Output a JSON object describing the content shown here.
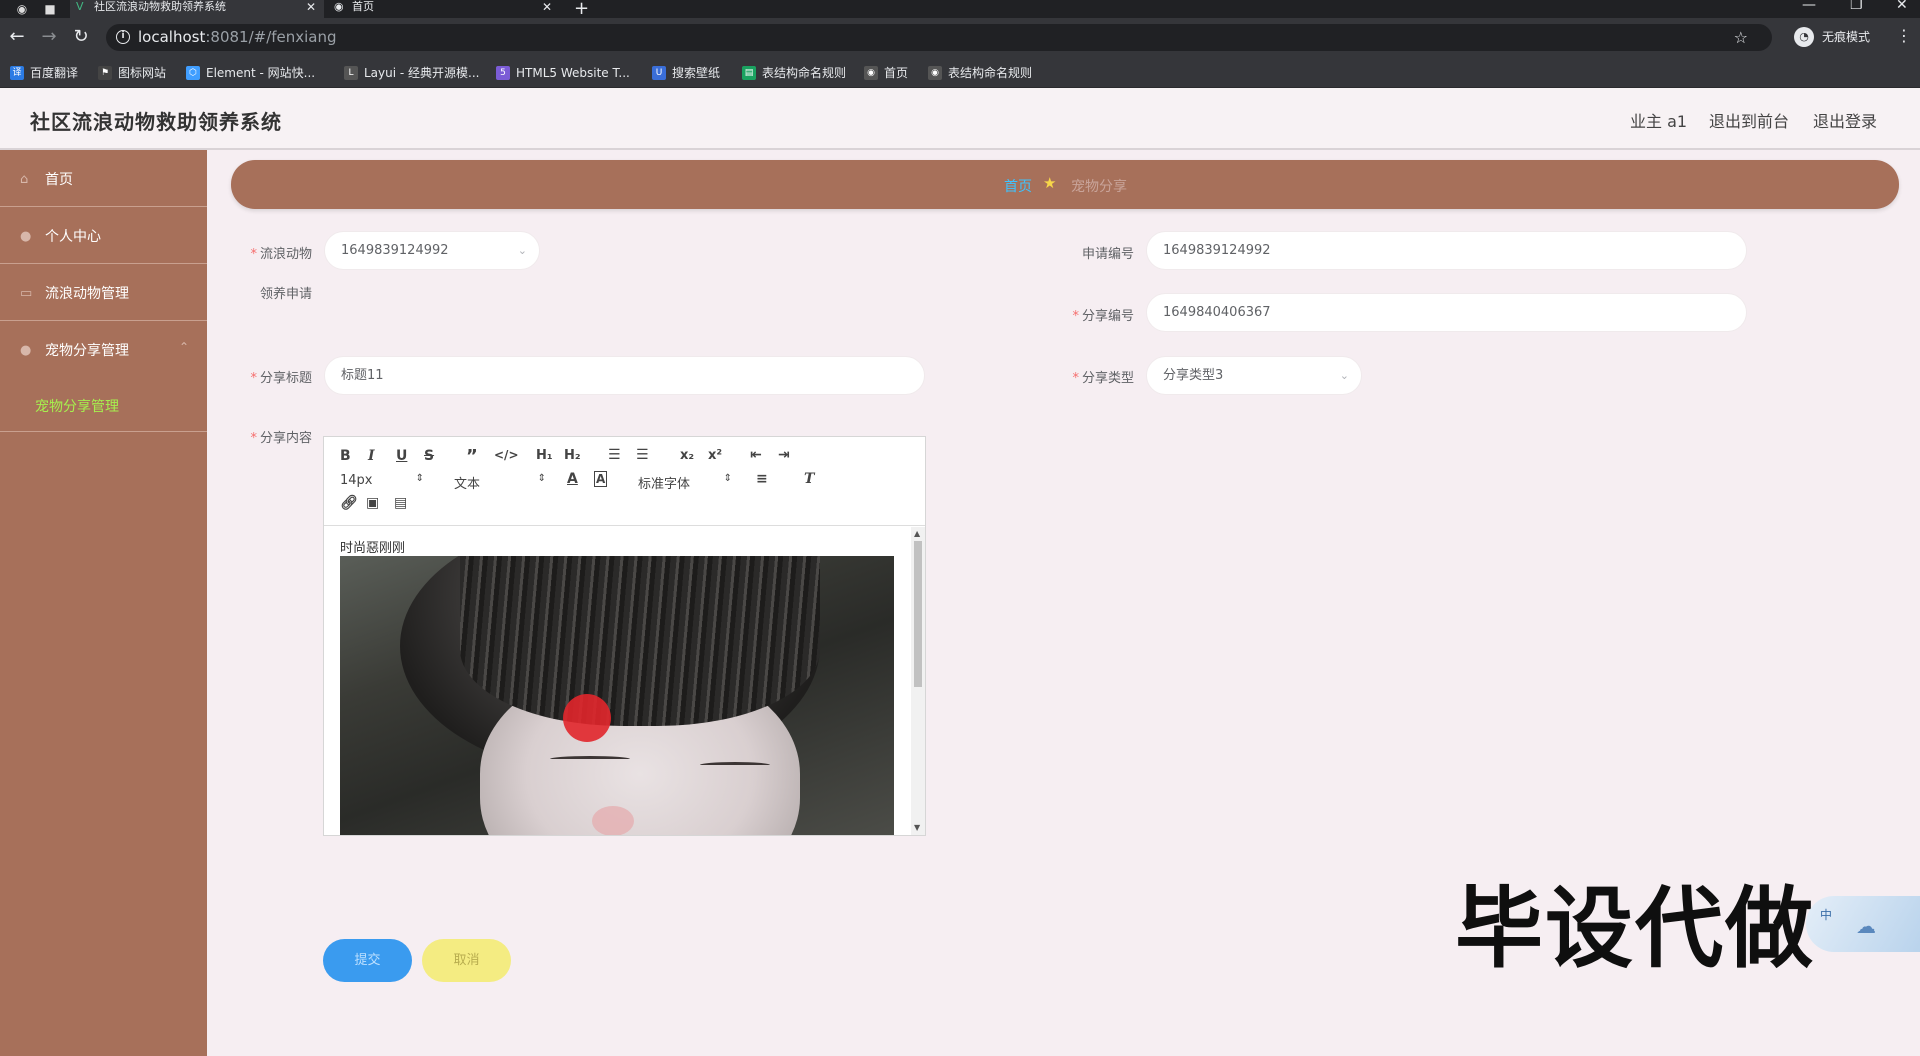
{
  "browser": {
    "tabs": [
      {
        "title": "社区流浪动物救助领养系统",
        "active": true
      },
      {
        "title": "首页",
        "active": false
      }
    ],
    "url_host": "localhost",
    "url_path": ":8081/#/fenxiang",
    "incognito_label": "无痕模式",
    "bookmarks": [
      {
        "label": "百度翻译",
        "icon_color": "#2b7be4",
        "icon": "译"
      },
      {
        "label": "图标网站",
        "icon_color": "#444",
        "icon": "⚑"
      },
      {
        "label": "Element - 网站快...",
        "icon_color": "#409eff",
        "icon": "⬡"
      },
      {
        "label": "Layui - 经典开源模...",
        "icon_color": "#555",
        "icon": "L"
      },
      {
        "label": "HTML5 Website T...",
        "icon_color": "#7b5cd6",
        "icon": "5"
      },
      {
        "label": "搜索壁纸",
        "icon_color": "#3a6ed8",
        "icon": "U"
      },
      {
        "label": "表结构命名规则",
        "icon_color": "#1aa260",
        "icon": "▤"
      },
      {
        "label": "首页",
        "icon_color": "#555",
        "icon": "◉"
      },
      {
        "label": "表结构命名规则",
        "icon_color": "#555",
        "icon": "◉"
      }
    ]
  },
  "header": {
    "title": "社区流浪动物救助领养系统",
    "user": "业主 a1",
    "to_front": "退出到前台",
    "logout": "退出登录"
  },
  "sidebar": {
    "items": [
      {
        "label": "首页",
        "icon": "home-icon"
      },
      {
        "label": "个人中心",
        "icon": "user-icon"
      },
      {
        "label": "流浪动物管理",
        "icon": "grid-icon"
      },
      {
        "label": "宠物分享管理",
        "icon": "user-icon"
      }
    ],
    "submenu": "宠物分享管理"
  },
  "breadcrumb": {
    "home": "首页",
    "current": "宠物分享"
  },
  "form": {
    "animal_label": "流浪动物",
    "animal_label2": "领养申请",
    "animal_value": "1649839124992",
    "apply_no_label": "申请编号",
    "apply_no_value": "1649839124992",
    "share_no_label": "分享编号",
    "share_no_value": "1649840406367",
    "title_label": "分享标题",
    "title_value": "标题11",
    "type_label": "分享类型",
    "type_value": "分享类型3",
    "content_label": "分享内容"
  },
  "editor": {
    "font_size": "14px",
    "header_select": "文本",
    "font_family": "标准字体",
    "content_text": "时尚惡刚刚"
  },
  "buttons": {
    "submit": "提交",
    "cancel": "取消"
  },
  "overlay": {
    "watermark": "毕设代做",
    "ime": "中"
  }
}
